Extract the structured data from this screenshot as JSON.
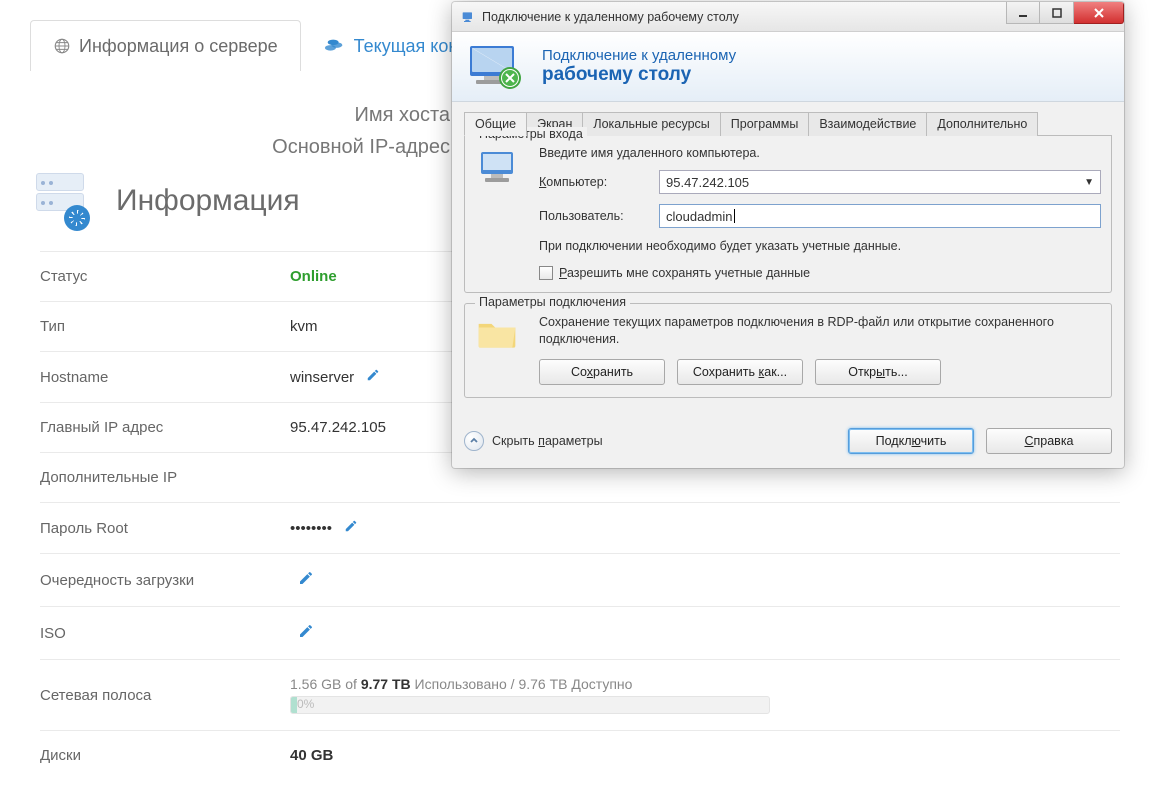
{
  "page": {
    "tabs": {
      "info": "Информация о сервере",
      "current": "Текущая кон"
    },
    "header": {
      "hostname_label": "Имя хоста",
      "ip_label": "Основной IP-адрес"
    },
    "section_title": "Информация",
    "rows": {
      "status_label": "Статус",
      "status_value": "Online",
      "type_label": "Тип",
      "type_value": "kvm",
      "hostname_label": "Hostname",
      "hostname_value": "winserver",
      "mainip_label": "Главный IP адрес",
      "mainip_value": "95.47.242.105",
      "extraip_label": "Дополнительные IP",
      "root_label": "Пароль Root",
      "root_value": "••••••••",
      "boot_label": "Очередность загрузки",
      "iso_label": "ISO",
      "band_label": "Сетевая полоса",
      "band_used": "1.56 GB",
      "band_of": "of",
      "band_total": "9.77 TB",
      "band_used_word": "Использовано",
      "band_avail": "9.76 TB Доступно",
      "band_pct": "0%",
      "disk_label": "Диски",
      "disk_value": "40 GB"
    }
  },
  "dialog": {
    "title": "Подключение к удаленному рабочему столу",
    "banner_line1": "Подключение к удаленному",
    "banner_line2": "рабочему столу",
    "tabs": [
      "Общие",
      "Экран",
      "Локальные ресурсы",
      "Программы",
      "Взаимодействие",
      "Дополнительно"
    ],
    "login": {
      "legend": "Параметры входа",
      "hint": "Введите имя удаленного компьютера.",
      "computer_label": "Компьютер:",
      "computer_value": "95.47.242.105",
      "user_label": "Пользователь:",
      "user_value": "cloudadmin",
      "creds_note": "При подключении необходимо будет указать учетные данные.",
      "checkbox": "Разрешить мне сохранять учетные данные"
    },
    "conn": {
      "legend": "Параметры подключения",
      "desc": "Сохранение текущих параметров подключения в RDP-файл или открытие сохраненного подключения.",
      "save": "Сохранить",
      "save_as": "Сохранить как...",
      "open": "Открыть..."
    },
    "footer": {
      "hide": "Скрыть параметры",
      "connect": "Подключить",
      "help": "Справка"
    }
  }
}
